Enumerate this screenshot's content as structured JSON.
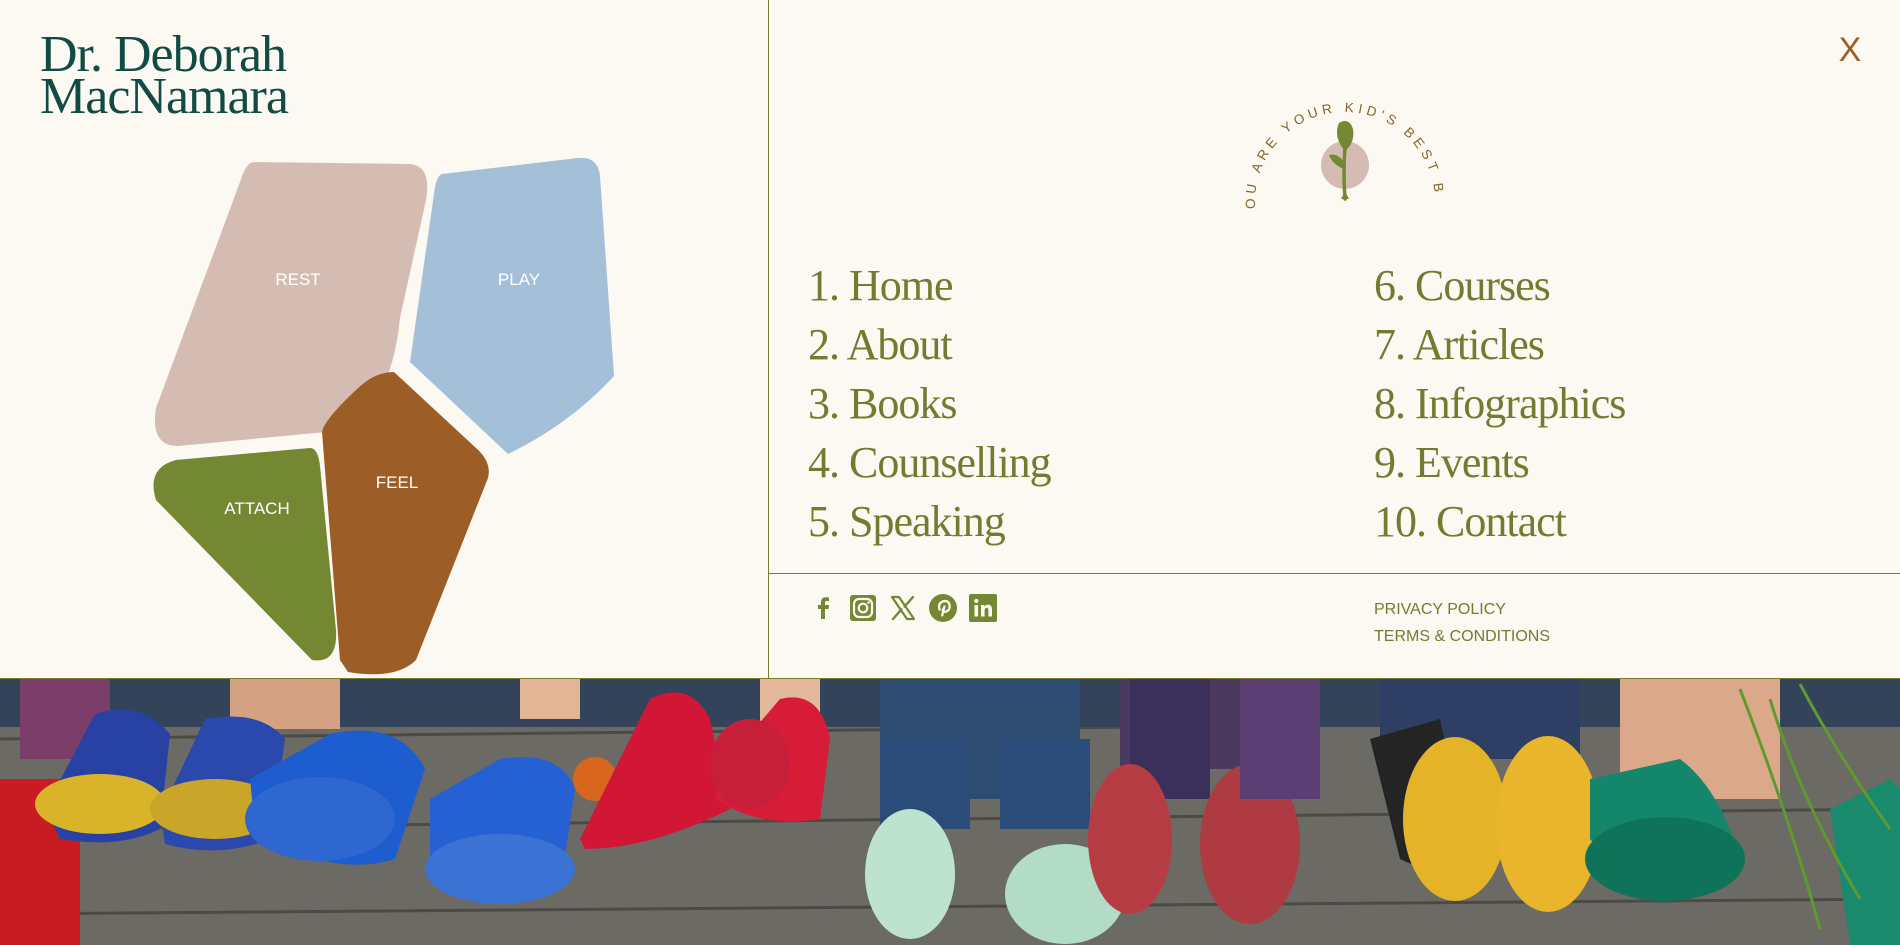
{
  "logo": {
    "line1": "Dr. Deborah",
    "line2": "MacNamara"
  },
  "shapes": {
    "rest": {
      "label": "REST",
      "color": "#d5bcb2"
    },
    "play": {
      "label": "PLAY",
      "color": "#a4bfd8"
    },
    "attach": {
      "label": "ATTACH",
      "color": "#748733"
    },
    "feel": {
      "label": "FEEL",
      "color": "#9c5d27"
    }
  },
  "close_label": "X",
  "badge": {
    "text": "YOU ARE YOUR KID'S BEST BET",
    "sprout_color": "#748733",
    "circle_color": "#d5bcb2"
  },
  "nav": {
    "column1": [
      {
        "label": "1. Home"
      },
      {
        "label": "2. About"
      },
      {
        "label": "3. Books"
      },
      {
        "label": "4. Counselling"
      },
      {
        "label": "5. Speaking"
      }
    ],
    "column2": [
      {
        "label": "6. Courses"
      },
      {
        "label": "7. Articles"
      },
      {
        "label": "8. Infographics"
      },
      {
        "label": "9. Events"
      },
      {
        "label": "10. Contact"
      }
    ]
  },
  "social": [
    "facebook-icon",
    "instagram-icon",
    "x-twitter-icon",
    "pinterest-icon",
    "linkedin-icon"
  ],
  "legal": {
    "privacy": "PRIVACY POLICY",
    "terms": "TERMS & CONDITIONS"
  },
  "colors": {
    "accent_green": "#748733",
    "text_olive": "#747b30",
    "logo_teal": "#104b44",
    "close_brown": "#9c5d27",
    "background": "#fcf8f2"
  }
}
